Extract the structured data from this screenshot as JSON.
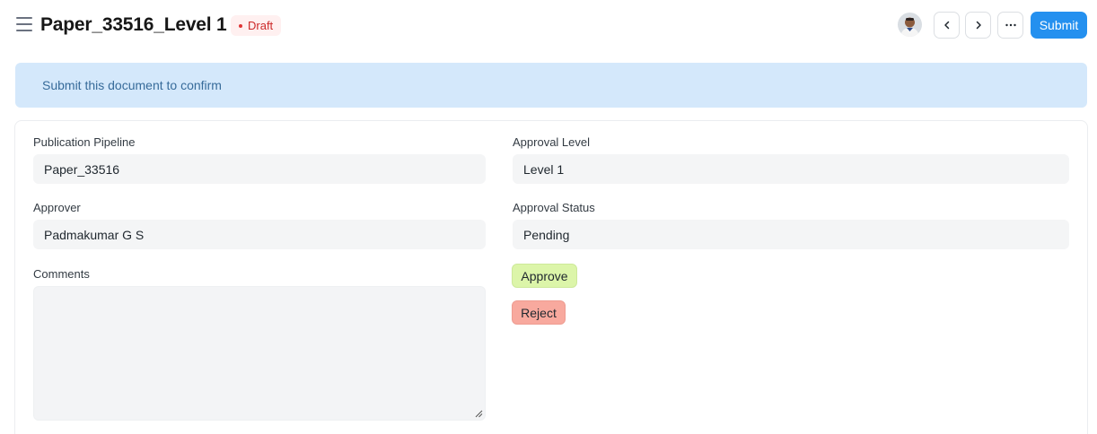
{
  "header": {
    "title": "Paper_33516_Level 1",
    "status": "Draft",
    "submit_label": "Submit",
    "more_label": "···"
  },
  "banner": {
    "text": "Submit this document to confirm"
  },
  "form": {
    "publication_pipeline": {
      "label": "Publication Pipeline",
      "value": "Paper_33516"
    },
    "approval_level": {
      "label": "Approval Level",
      "value": "Level 1"
    },
    "approver": {
      "label": "Approver",
      "value": "Padmakumar G S"
    },
    "approval_status": {
      "label": "Approval Status",
      "value": "Pending"
    },
    "comments": {
      "label": "Comments",
      "value": ""
    }
  },
  "actions": {
    "approve_label": "Approve",
    "reject_label": "Reject"
  },
  "colors": {
    "primary": "#2490ef",
    "banner_bg": "#d4e8fb",
    "draft_badge_bg": "#fff0f0",
    "draft_badge_text": "#cc2929",
    "approve_bg": "#dcf5a9",
    "reject_bg": "#f8a99e"
  },
  "icons": {
    "menu": "hamburger-icon",
    "prev": "chevron-left-icon",
    "next": "chevron-right-icon",
    "more": "ellipsis-icon"
  }
}
